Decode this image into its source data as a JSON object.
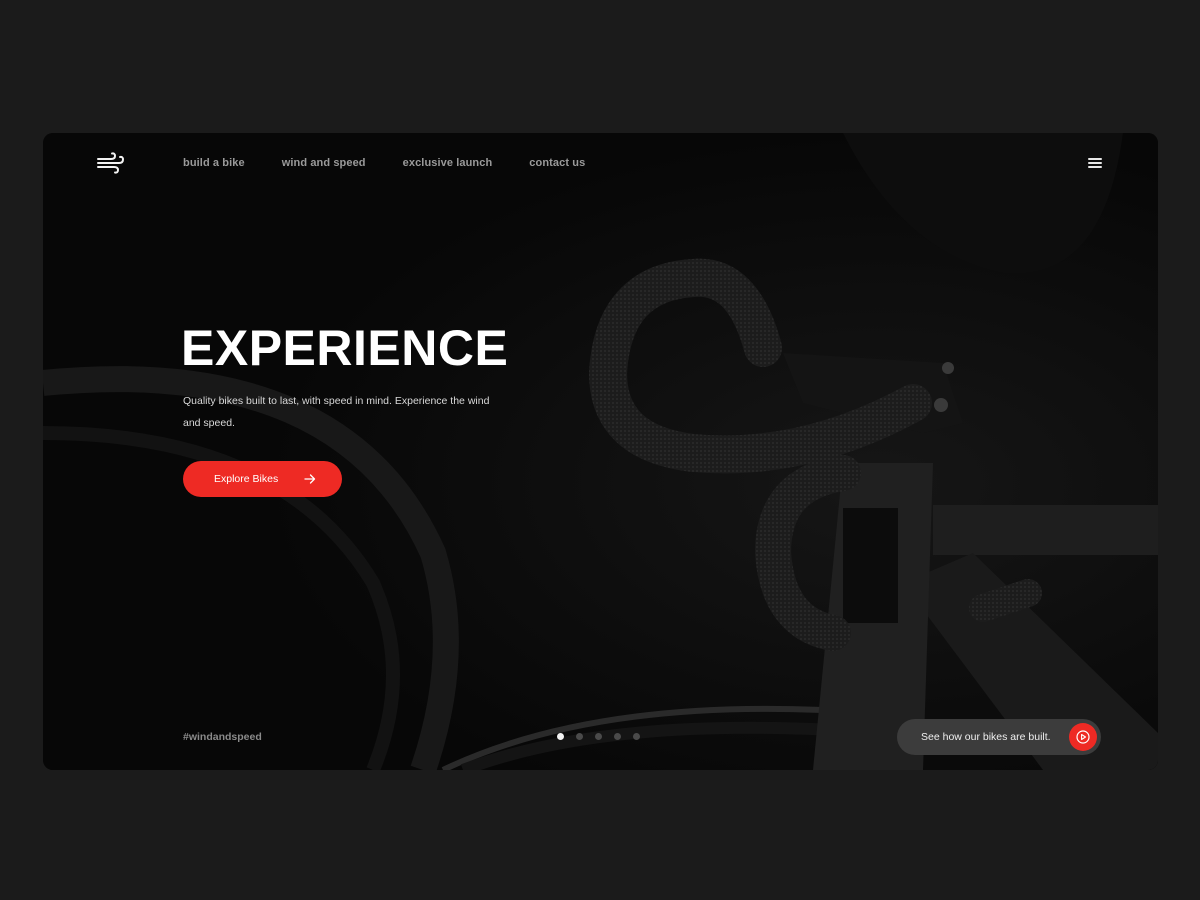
{
  "brand": {
    "logo_icon": "wind-icon"
  },
  "nav": {
    "items": [
      {
        "label": "build a bike"
      },
      {
        "label": "wind and speed"
      },
      {
        "label": "exclusive launch"
      },
      {
        "label": "contact us"
      }
    ],
    "menu_icon": "hamburger-menu-icon"
  },
  "hero": {
    "title": "EXPERIENCE",
    "description": "Quality bikes built to last, with speed in mind. Experience the wind and speed.",
    "cta_label": "Explore Bikes",
    "cta_icon": "arrow-right-icon",
    "image": "black road bike handlebars"
  },
  "footer": {
    "hashtag": "#windandspeed",
    "carousel": {
      "total": 5,
      "active_index": 0
    },
    "video_cta_label": "See how our bikes are built.",
    "video_icon": "play-icon"
  },
  "colors": {
    "accent": "#ee2a24",
    "page_bg": "#1b1b1b",
    "frame_bg": "#070707",
    "pill_bg": "#3c3c3c"
  }
}
